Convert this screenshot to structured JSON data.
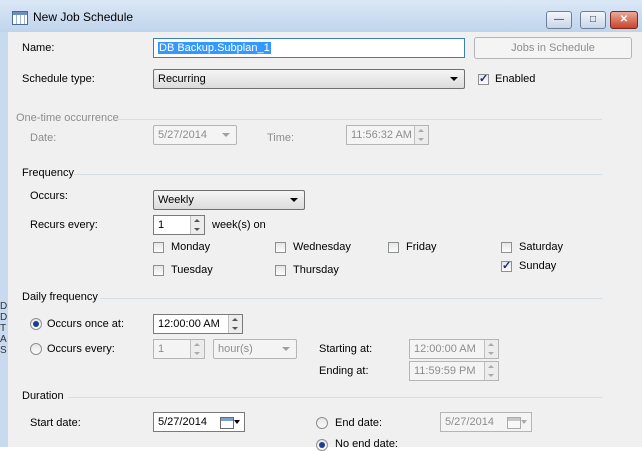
{
  "window": {
    "title": "New Job Schedule"
  },
  "left_clip": [
    "D",
    "D",
    "T",
    "A",
    "S"
  ],
  "name": {
    "label": "Name:",
    "value": "DB Backup.Subplan_1",
    "jobs_button": "Jobs in Schedule"
  },
  "schedule_type": {
    "label": "Schedule type:",
    "value": "Recurring",
    "enabled_label": "Enabled",
    "enabled": true
  },
  "one_time": {
    "header": "One-time occurrence",
    "date_label": "Date:",
    "date_value": "5/27/2014",
    "time_label": "Time:",
    "time_value": "11:56:32 AM"
  },
  "frequency": {
    "header": "Frequency",
    "occurs_label": "Occurs:",
    "occurs_value": "Weekly",
    "recurs_label": "Recurs every:",
    "recurs_value": "1",
    "recurs_unit": "week(s) on",
    "days": {
      "monday": {
        "label": "Monday",
        "checked": false
      },
      "tuesday": {
        "label": "Tuesday",
        "checked": false
      },
      "wednesday": {
        "label": "Wednesday",
        "checked": false
      },
      "thursday": {
        "label": "Thursday",
        "checked": false
      },
      "friday": {
        "label": "Friday",
        "checked": false
      },
      "saturday": {
        "label": "Saturday",
        "checked": false
      },
      "sunday": {
        "label": "Sunday",
        "checked": true
      }
    }
  },
  "daily": {
    "header": "Daily frequency",
    "once_label": "Occurs once at:",
    "once_value": "12:00:00 AM",
    "every_label": "Occurs every:",
    "every_value": "1",
    "every_unit": "hour(s)",
    "starting_label": "Starting at:",
    "starting_value": "12:00:00 AM",
    "ending_label": "Ending at:",
    "ending_value": "11:59:59 PM"
  },
  "duration": {
    "header": "Duration",
    "start_label": "Start date:",
    "start_value": "5/27/2014",
    "end_label": "End date:",
    "end_value": "5/27/2014",
    "no_end_label": "No end date:"
  }
}
